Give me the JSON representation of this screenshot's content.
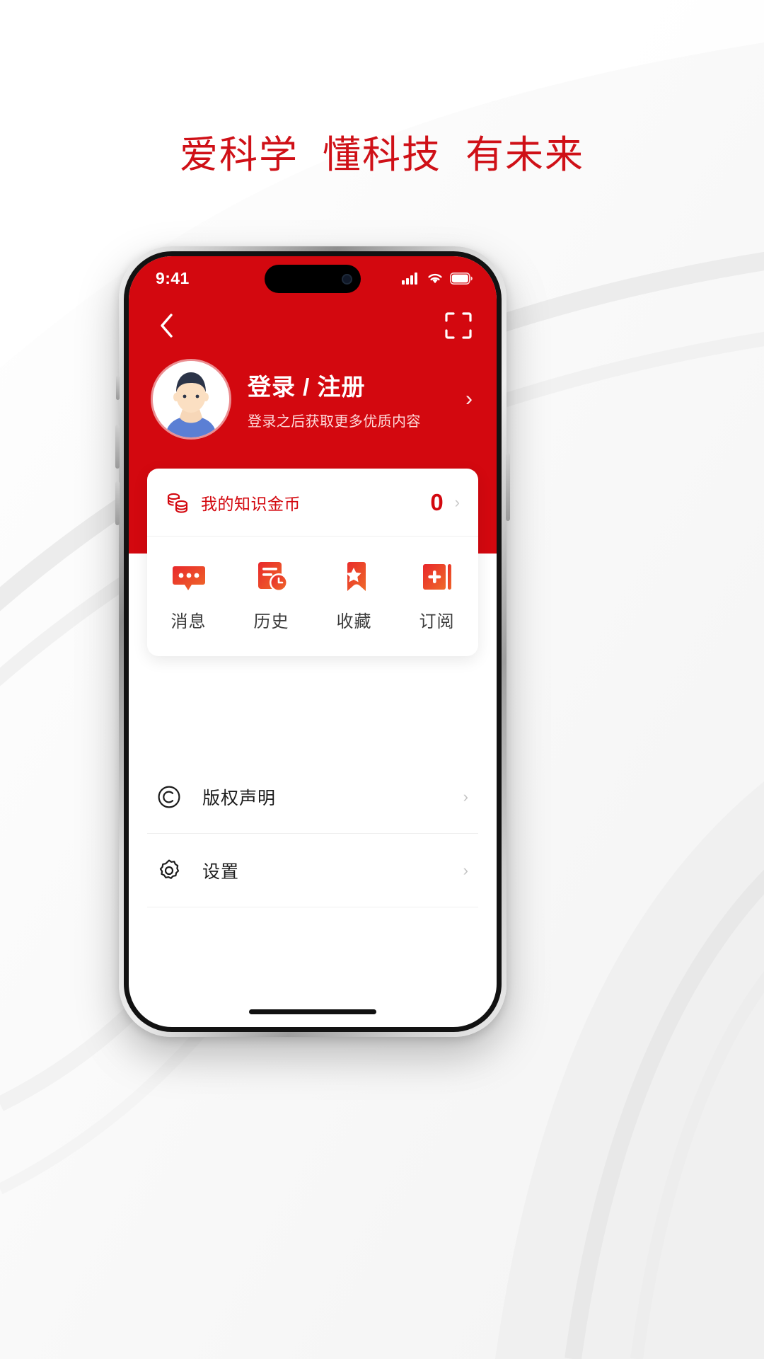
{
  "page": {
    "headline": "爱科学  懂科技  有未来",
    "headline_color": "#cf1017",
    "brand_red": "#d3080f"
  },
  "statusbar": {
    "time": "9:41",
    "signal_icon": "cellular-signal-icon",
    "wifi_icon": "wifi-icon",
    "battery_icon": "battery-icon"
  },
  "navbar": {
    "back_icon": "back-chevron-icon",
    "scan_icon": "scan-qr-icon"
  },
  "profile": {
    "avatar_icon": "user-avatar",
    "title": "登录 / 注册",
    "subtitle": "登录之后获取更多优质内容",
    "arrow": "›"
  },
  "coin": {
    "icon": "coins-stack-icon",
    "label": "我的知识金币",
    "value": "0",
    "arrow": "›"
  },
  "quick_actions": [
    {
      "label": "消息",
      "icon": "message-bubble-icon"
    },
    {
      "label": "历史",
      "icon": "history-clock-icon"
    },
    {
      "label": "收藏",
      "icon": "bookmark-star-icon"
    },
    {
      "label": "订阅",
      "icon": "subscribe-plus-icon"
    }
  ],
  "menu": [
    {
      "label": "版权声明",
      "icon": "copyright-icon",
      "arrow": "›"
    },
    {
      "label": "设置",
      "icon": "gear-icon",
      "arrow": "›"
    }
  ]
}
